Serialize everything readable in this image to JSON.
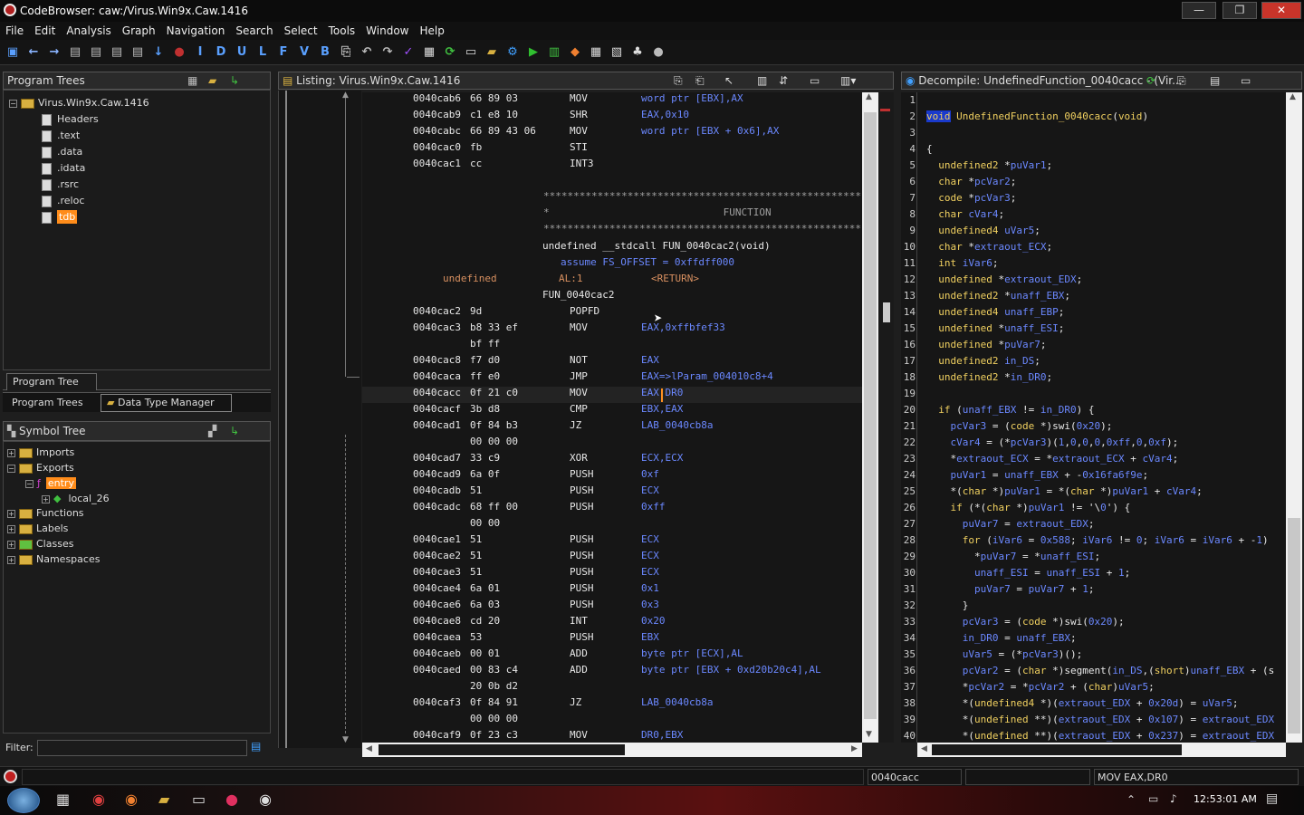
{
  "window": {
    "title": "CodeBrowser: caw:/Virus.Win9x.Caw.1416",
    "minimize": "—",
    "maximize": "❐",
    "close": "✕"
  },
  "menu": [
    "File",
    "Edit",
    "Analysis",
    "Graph",
    "Navigation",
    "Search",
    "Select",
    "Tools",
    "Window",
    "Help"
  ],
  "toolbar_letters": [
    "I",
    "D",
    "U",
    "L",
    "F",
    "V",
    "B"
  ],
  "program_trees": {
    "title": "Program Trees",
    "root": "Virus.Win9x.Caw.1416",
    "children": [
      "Headers",
      ".text",
      ".data",
      ".idata",
      ".rsrc",
      ".reloc",
      "tdb"
    ],
    "tab_program_tree": "Program Tree",
    "tab_program_trees": "Program Trees",
    "tab_data_type_manager": "Data Type Manager"
  },
  "symbol_tree": {
    "title": "Symbol Tree",
    "imports": "Imports",
    "exports": "Exports",
    "entry": "entry",
    "local": "local_26",
    "functions": "Functions",
    "labels": "Labels",
    "classes": "Classes",
    "namespaces": "Namespaces",
    "filter_label": "Filter:"
  },
  "listing": {
    "title": "Listing:  Virus.Win9x.Caw.1416",
    "rows": [
      {
        "addr": "0040cab6",
        "bytes": "66 89 03",
        "mn": "MOV",
        "op": "word ptr [EBX],AX"
      },
      {
        "addr": "0040cab9",
        "bytes": "c1 e8 10",
        "mn": "SHR",
        "op": "EAX,0x10"
      },
      {
        "addr": "0040cabc",
        "bytes": "66 89 43 06",
        "mn": "MOV",
        "op": "word ptr [EBX + 0x6],AX"
      },
      {
        "addr": "0040cac0",
        "bytes": "fb",
        "mn": "STI",
        "op": ""
      },
      {
        "addr": "0040cac1",
        "bytes": "cc",
        "mn": "INT3",
        "op": ""
      }
    ],
    "stars": "**************************************************************",
    "function_banner": "*                             FUNCTION",
    "signature": "undefined __stdcall FUN_0040cac2(void)",
    "assume": "assume FS_OFFSET = 0xffdff000",
    "ret_type": "undefined",
    "ret_reg": "AL:1",
    "ret_label": "<RETURN>",
    "func_label": "FUN_0040cac2",
    "rows2": [
      {
        "addr": "0040cac2",
        "bytes": "9d",
        "mn": "POPFD",
        "op": ""
      },
      {
        "addr": "0040cac3",
        "bytes": "b8 33 ef",
        "mn": "MOV",
        "op": "EAX,0xffbfef33"
      },
      {
        "addr": "",
        "bytes": "bf ff",
        "mn": "",
        "op": ""
      },
      {
        "addr": "0040cac8",
        "bytes": "f7 d0",
        "mn": "NOT",
        "op": "EAX"
      },
      {
        "addr": "0040caca",
        "bytes": "ff e0",
        "mn": "JMP",
        "op": "EAX=>lParam_004010c8+4"
      },
      {
        "addr": "0040cacc",
        "bytes": "0f 21 c0",
        "mn": "MOV",
        "op": "EAX,DR0"
      },
      {
        "addr": "0040cacf",
        "bytes": "3b d8",
        "mn": "CMP",
        "op": "EBX,EAX"
      },
      {
        "addr": "0040cad1",
        "bytes": "0f 84 b3",
        "mn": "JZ",
        "op": "LAB_0040cb8a"
      },
      {
        "addr": "",
        "bytes": "00 00 00",
        "mn": "",
        "op": ""
      },
      {
        "addr": "0040cad7",
        "bytes": "33 c9",
        "mn": "XOR",
        "op": "ECX,ECX"
      },
      {
        "addr": "0040cad9",
        "bytes": "6a 0f",
        "mn": "PUSH",
        "op": "0xf"
      },
      {
        "addr": "0040cadb",
        "bytes": "51",
        "mn": "PUSH",
        "op": "ECX"
      },
      {
        "addr": "0040cadc",
        "bytes": "68 ff 00",
        "mn": "PUSH",
        "op": "0xff"
      },
      {
        "addr": "",
        "bytes": "00 00",
        "mn": "",
        "op": ""
      },
      {
        "addr": "0040cae1",
        "bytes": "51",
        "mn": "PUSH",
        "op": "ECX"
      },
      {
        "addr": "0040cae2",
        "bytes": "51",
        "mn": "PUSH",
        "op": "ECX"
      },
      {
        "addr": "0040cae3",
        "bytes": "51",
        "mn": "PUSH",
        "op": "ECX"
      },
      {
        "addr": "0040cae4",
        "bytes": "6a 01",
        "mn": "PUSH",
        "op": "0x1"
      },
      {
        "addr": "0040cae6",
        "bytes": "6a 03",
        "mn": "PUSH",
        "op": "0x3"
      },
      {
        "addr": "0040cae8",
        "bytes": "cd 20",
        "mn": "INT",
        "op": "0x20"
      },
      {
        "addr": "0040caea",
        "bytes": "53",
        "mn": "PUSH",
        "op": "EBX"
      },
      {
        "addr": "0040caeb",
        "bytes": "00 01",
        "mn": "ADD",
        "op": "byte ptr [ECX],AL"
      },
      {
        "addr": "0040caed",
        "bytes": "00 83 c4",
        "mn": "ADD",
        "op": "byte ptr [EBX + 0xd20b20c4],AL"
      },
      {
        "addr": "",
        "bytes": "20 0b d2",
        "mn": "",
        "op": ""
      },
      {
        "addr": "0040caf3",
        "bytes": "0f 84 91",
        "mn": "JZ",
        "op": "LAB_0040cb8a"
      },
      {
        "addr": "",
        "bytes": "00 00 00",
        "mn": "",
        "op": ""
      },
      {
        "addr": "0040caf9",
        "bytes": "0f 23 c3",
        "mn": "MOV",
        "op": "DR0,EBX"
      }
    ]
  },
  "decompile": {
    "title": "Decompile: UndefinedFunction_0040cacc - (Vir...",
    "lines": [
      "",
      "void UndefinedFunction_0040cacc(void)",
      "",
      "{",
      "  undefined2 *puVar1;",
      "  char *pcVar2;",
      "  code *pcVar3;",
      "  char cVar4;",
      "  undefined4 uVar5;",
      "  char *extraout_ECX;",
      "  int iVar6;",
      "  undefined *extraout_EDX;",
      "  undefined2 *unaff_EBX;",
      "  undefined4 unaff_EBP;",
      "  undefined *unaff_ESI;",
      "  undefined *puVar7;",
      "  undefined2 in_DS;",
      "  undefined2 *in_DR0;",
      "",
      "  if (unaff_EBX != in_DR0) {",
      "    pcVar3 = (code *)swi(0x20);",
      "    cVar4 = (*pcVar3)(1,0,0,0,0xff,0,0xf);",
      "    *extraout_ECX = *extraout_ECX + cVar4;",
      "    puVar1 = unaff_EBX + -0x16fa6f9e;",
      "    *(char *)puVar1 = *(char *)puVar1 + cVar4;",
      "    if (*(char *)puVar1 != '\\0') {",
      "      puVar7 = extraout_EDX;",
      "      for (iVar6 = 0x588; iVar6 != 0; iVar6 = iVar6 + -1)",
      "        *puVar7 = *unaff_ESI;",
      "        unaff_ESI = unaff_ESI + 1;",
      "        puVar7 = puVar7 + 1;",
      "      }",
      "      pcVar3 = (code *)swi(0x20);",
      "      in_DR0 = unaff_EBX;",
      "      uVar5 = (*pcVar3)();",
      "      pcVar2 = (char *)segment(in_DS,(short)unaff_EBX + (s",
      "      *pcVar2 = *pcVar2 + (char)uVar5;",
      "      *(undefined4 *)(extraout_EDX + 0x20d) = uVar5;",
      "      *(undefined **)(extraout_EDX + 0x107) = extraout_EDX",
      "      *(undefined **)(extraout_EDX + 0x237) = extraout_EDX"
    ]
  },
  "status": {
    "address": "0040cacc",
    "instruction": "MOV EAX,DR0"
  },
  "taskbar": {
    "time": "12:53:01 AM"
  },
  "colors": {
    "background": "#1e1e1e",
    "operand_blue": "#6b88ff",
    "keyword_yellow": "#f0d060",
    "highlight_orange": "#ff8c1a"
  }
}
